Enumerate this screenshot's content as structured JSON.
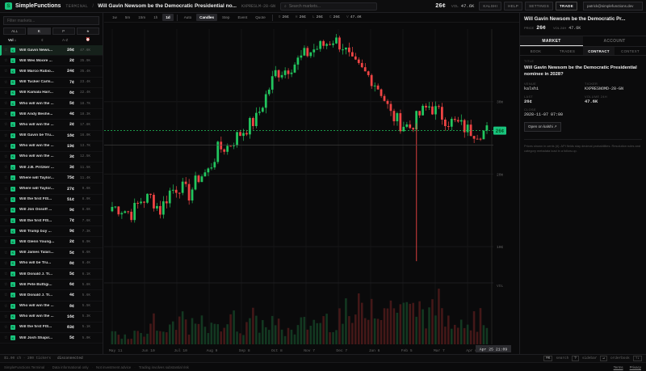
{
  "app": {
    "brand": "SimpleFunctions",
    "mode": "TERMINAL",
    "title": "Will Gavin Newsom be the Democratic Presidential no...",
    "ticker": "KXPRESLM-28-GN",
    "search_placeholder": "Search markets...",
    "price": "26¢",
    "vol_label": "VOL",
    "vol": "47.6K",
    "badge": "KALSHI",
    "buttons": [
      "HELP",
      "SETTINGS",
      "TRADE"
    ],
    "user": "patrick@simplefunctions.dev"
  },
  "sidebar": {
    "filter_placeholder": "Filter markets...",
    "tabs": [
      "ALL",
      "K",
      "P",
      "★"
    ],
    "sort": [
      "Vol ↓",
      "¢",
      "A-Z",
      "⏰"
    ],
    "items": [
      {
        "title": "Will Gavin News...",
        "price": "26¢",
        "vol": "47.6K"
      },
      {
        "title": "Will Wes Moore ...",
        "price": "2¢",
        "vol": "35.9K"
      },
      {
        "title": "Will Marco Rubio...",
        "price": "24¢",
        "vol": "35.4K"
      },
      {
        "title": "Will Tucker Carls...",
        "price": "7¢",
        "vol": "23.4K"
      },
      {
        "title": "Will Kamala Harr...",
        "price": "8¢",
        "vol": "22.4K"
      },
      {
        "title": "Who will win the ...",
        "price": "5¢",
        "vol": "18.7K"
      },
      {
        "title": "Will Andy Beshe...",
        "price": "4¢",
        "vol": "18.3K"
      },
      {
        "title": "Who will win the ...",
        "price": "2¢",
        "vol": "17.8K"
      },
      {
        "title": "Will Gavin be Tru...",
        "price": "18¢",
        "vol": "16.0K"
      },
      {
        "title": "Who will win the ...",
        "price": "19¢",
        "vol": "13.7K"
      },
      {
        "title": "Who will win the ...",
        "price": "3¢",
        "vol": "12.5K"
      },
      {
        "title": "Will J.B. Pritzker ...",
        "price": "3¢",
        "vol": "11.5K"
      },
      {
        "title": "Where will Taylor...",
        "price": "75¢",
        "vol": "11.4K"
      },
      {
        "title": "Where will Taylor...",
        "price": "27¢",
        "vol": "9.6K"
      },
      {
        "title": "Will the first FIS...",
        "price": "51¢",
        "vol": "8.9K"
      },
      {
        "title": "Will Jon Ossoff ...",
        "price": "9¢",
        "vol": "8.6K"
      },
      {
        "title": "Will the first FIS...",
        "price": "7¢",
        "vol": "7.6K"
      },
      {
        "title": "Will Trump buy ...",
        "price": "9¢",
        "vol": "7.3K"
      },
      {
        "title": "Will Glenn Young...",
        "price": "2¢",
        "vol": "6.9K"
      },
      {
        "title": "Will James Talari...",
        "price": "5¢",
        "vol": "6.6K"
      },
      {
        "title": "Who will be Tru...",
        "price": "8¢",
        "vol": "6.4K"
      },
      {
        "title": "Will Donald J. Tr...",
        "price": "5¢",
        "vol": "6.1K"
      },
      {
        "title": "Will Pete Buttigi...",
        "price": "6¢",
        "vol": "5.8K"
      },
      {
        "title": "Will Donald J. Tr...",
        "price": "4¢",
        "vol": "5.6K"
      },
      {
        "title": "Who will win the ...",
        "price": "8¢",
        "vol": "5.5K"
      },
      {
        "title": "Who will win the ...",
        "price": "16¢",
        "vol": "5.3K"
      },
      {
        "title": "Will the first FIS...",
        "price": "83¢",
        "vol": "5.1K"
      },
      {
        "title": "Will Josh Shapir...",
        "price": "5¢",
        "vol": "5.0K"
      }
    ]
  },
  "toolbar": {
    "ranges": [
      "1w",
      "5m",
      "15m",
      "1h",
      "1d"
    ],
    "active_range": "1d",
    "styles": [
      "Auto",
      "Candles",
      "Step",
      "Event",
      "Quote"
    ],
    "active_style": "Candles",
    "stats": [
      {
        "label": "O",
        "value": "26¢"
      },
      {
        "label": "H",
        "value": "26¢"
      },
      {
        "label": "L",
        "value": "26¢"
      },
      {
        "label": "C",
        "value": "26¢"
      },
      {
        "label": "V",
        "value": "47.4K"
      }
    ]
  },
  "chart": {
    "price_label": "26¢",
    "y_ticks": [
      "30¢",
      "20¢",
      "10¢"
    ],
    "vol_label": "VOL",
    "x_ticks": [
      "May 11",
      "Jun 10",
      "Jul 10",
      "Aug 9",
      "Sep 8",
      "Oct 8",
      "Nov 7",
      "Dec 7",
      "Jan 6",
      "Feb 5",
      "Mar 7",
      "Apr 6"
    ],
    "cursor_date": "Apr 25 21:09",
    "up_color": "#22c55e",
    "down_color": "#ef4444"
  },
  "chart_data": {
    "type": "candlestick",
    "title": "",
    "y_unit": "¢",
    "ylim": [
      5,
      40
    ],
    "grid": true,
    "closes": [
      15.5,
      15.2,
      14.6,
      16.4,
      16.8,
      15.0,
      17.6,
      18.4,
      17.2,
      19.6,
      20.4,
      23.4,
      23.8,
      25.2,
      26.4,
      27.6,
      30.8,
      34.0,
      34.4,
      35.3,
      36.4,
      37.2,
      37.8,
      38.6,
      37.7,
      35.2,
      34.2,
      33.2,
      31.4,
      28.2,
      27.0,
      26.5,
      28.2,
      29.4,
      28.4,
      27.3,
      26.9,
      26.1,
      25.8,
      26.0
    ],
    "volumes": [
      0.3,
      0.2,
      0.25,
      0.3,
      0.5,
      0.3,
      0.35,
      0.6,
      0.4,
      0.45,
      0.35,
      0.5,
      0.55,
      0.4,
      0.6,
      0.45,
      0.5,
      0.4,
      0.3,
      0.35,
      0.45,
      0.5,
      0.6,
      0.55,
      0.7,
      0.6,
      0.8,
      1.0,
      0.9,
      0.85,
      0.95,
      0.75,
      0.8,
      0.7,
      0.9,
      0.6,
      0.75,
      0.5,
      0.55,
      0.6
    ],
    "current_price": 26
  },
  "panel": {
    "title": "Will Gavin Newsom be the Democratic Pr...",
    "price_label": "PRICE",
    "price": "26¢",
    "vol_label": "VOL 24H",
    "vol": "47.6K",
    "main_tabs": [
      "MARKET",
      "ACCOUNT"
    ],
    "sub_tabs": [
      "BOOK",
      "TRADES",
      "CONTRACT",
      "CONTEXT"
    ],
    "q_label": "TITLE",
    "question": "Will Gavin Newsom be the Democratic Presidential nominee in 2028?",
    "fields": [
      {
        "label": "VENUE",
        "value": "kalshi"
      },
      {
        "label": "TICKER",
        "value": "KXPRESNOMD-28-GN"
      },
      {
        "label": "LAST",
        "value": "26¢"
      },
      {
        "label": "VOLUME 24H",
        "value": "47.6K"
      }
    ],
    "close_label": "CLOSE",
    "close": "2028-11-07 07:00",
    "open_link": "Open on kalshi ↗",
    "note": "Prices shown in cents (¢). API fields stay decimal probabilities. Resolution rules and category metadata load in a follow-up."
  },
  "status": {
    "left": "$1.00 ch · 200 tickers",
    "conn": "disconnected",
    "keys": [
      {
        "k": "⌘K",
        "t": "search"
      },
      {
        "k": "?",
        "t": "sidebar"
      },
      {
        "k": "↵",
        "t": "orderbook"
      },
      {
        "k": "↑↓",
        "t": ""
      }
    ]
  },
  "footer": {
    "items": [
      "SimpleFunctions Terminal",
      "Data informational only",
      "Not investment advice",
      "Trading involves substantial risk"
    ],
    "links": [
      "Terms",
      "Privacy"
    ]
  }
}
